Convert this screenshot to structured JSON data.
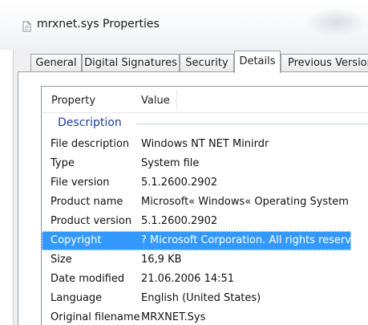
{
  "window": {
    "title": "mrxnet.sys Properties",
    "title_icon": "document-icon"
  },
  "tabs": [
    {
      "label": "General",
      "active": false
    },
    {
      "label": "Digital Signatures",
      "active": false
    },
    {
      "label": "Security",
      "active": false
    },
    {
      "label": "Details",
      "active": true
    },
    {
      "label": "Previous Versions",
      "active": false
    }
  ],
  "columns": {
    "property": "Property",
    "value": "Value"
  },
  "group": {
    "label": "Description"
  },
  "rows": [
    {
      "property": "File description",
      "value": "Windows NT NET Minirdr"
    },
    {
      "property": "Type",
      "value": "System file"
    },
    {
      "property": "File version",
      "value": "5.1.2600.2902"
    },
    {
      "property": "Product name",
      "value": "Microsoft« Windows« Operating System"
    },
    {
      "property": "Product version",
      "value": "5.1.2600.2902"
    },
    {
      "property": "Copyright",
      "value": "? Microsoft Corporation. All rights reserv...",
      "selected": true
    },
    {
      "property": "Size",
      "value": "16,9 KB"
    },
    {
      "property": "Date modified",
      "value": "21.06.2006 14:51"
    },
    {
      "property": "Language",
      "value": "English (United States)"
    },
    {
      "property": "Original filename",
      "value": "MRXNET.Sys"
    }
  ],
  "colors": {
    "selection": "#3399ff",
    "group_label": "#1c3f9c"
  }
}
